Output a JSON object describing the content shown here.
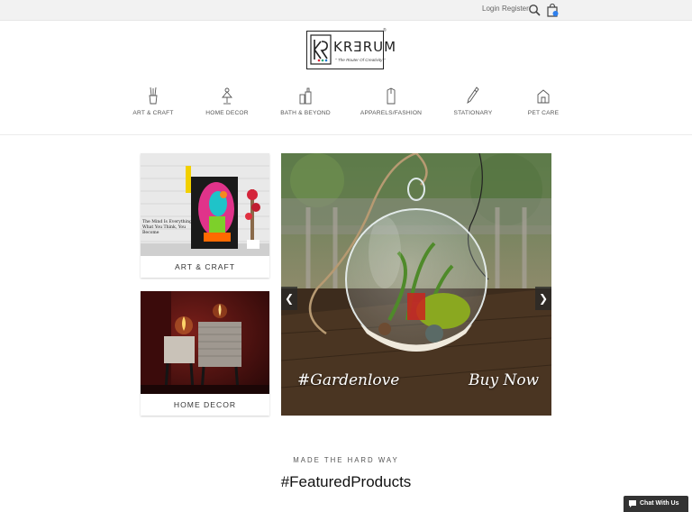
{
  "header": {
    "login_label": "Login",
    "register_label": "Register",
    "search_icon": "search-icon",
    "cart_icon": "shopping-bag-icon"
  },
  "logo": {
    "wordmark": "KRƎRUM",
    "tagline": "\" The Router Of Creativity \"",
    "trademark": "®"
  },
  "nav": {
    "items": [
      {
        "label": "ART & CRAFT",
        "icon": "brushes-icon"
      },
      {
        "label": "HOME DECOR",
        "icon": "lamp-icon"
      },
      {
        "label": "BATH & BEYOND",
        "icon": "bath-bottles-icon"
      },
      {
        "label": "APPARELS/FASHION",
        "icon": "apparel-icon"
      },
      {
        "label": "STATIONARY",
        "icon": "pen-icon"
      },
      {
        "label": "PET CARE",
        "icon": "pet-house-icon"
      }
    ]
  },
  "categories": [
    {
      "label": "ART & CRAFT",
      "image_text": "The Mind Is Everything What You Think, You Become"
    },
    {
      "label": "HOME DECOR"
    }
  ],
  "hero": {
    "caption_left": "#Gardenlove",
    "caption_right": "Buy Now",
    "prev_icon": "chevron-left-icon",
    "next_icon": "chevron-right-icon"
  },
  "featured": {
    "subheading": "MADE THE HARD WAY",
    "heading": "#FeaturedProducts"
  },
  "chat": {
    "label": "Chat With Us"
  },
  "colors": {
    "topbar_bg": "#f2f2f2",
    "text": "#333333",
    "chat_bg": "#333333"
  }
}
